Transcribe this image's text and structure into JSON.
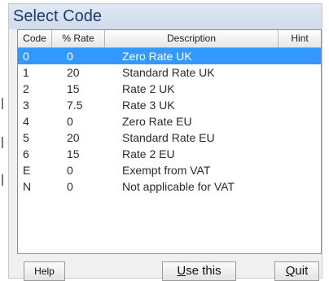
{
  "dialog": {
    "title": "Select Code"
  },
  "table": {
    "columns": [
      "Code",
      "% Rate",
      "Description",
      "Hint"
    ],
    "rows": [
      {
        "code": "0",
        "rate": "0",
        "description": "Zero Rate UK",
        "selected": true
      },
      {
        "code": "1",
        "rate": "20",
        "description": "Standard Rate UK"
      },
      {
        "code": "2",
        "rate": "15",
        "description": "Rate 2 UK"
      },
      {
        "code": "3",
        "rate": "7.5",
        "description": "Rate 3 UK"
      },
      {
        "code": "4",
        "rate": "0",
        "description": "Zero Rate EU"
      },
      {
        "code": "5",
        "rate": "20",
        "description": "Standard Rate EU"
      },
      {
        "code": "6",
        "rate": "15",
        "description": "Rate 2 EU"
      },
      {
        "code": "E",
        "rate": "0",
        "description": "Exempt from VAT"
      },
      {
        "code": "N",
        "rate": "0",
        "description": "Not applicable for VAT"
      }
    ]
  },
  "buttons": {
    "help": "Help",
    "use_this_mnemonic": "U",
    "use_this_rest": "se this",
    "quit_mnemonic": "Q",
    "quit_rest": "uit"
  },
  "colors": {
    "selection": "#3399ff",
    "title_text": "#1e3a6e"
  }
}
